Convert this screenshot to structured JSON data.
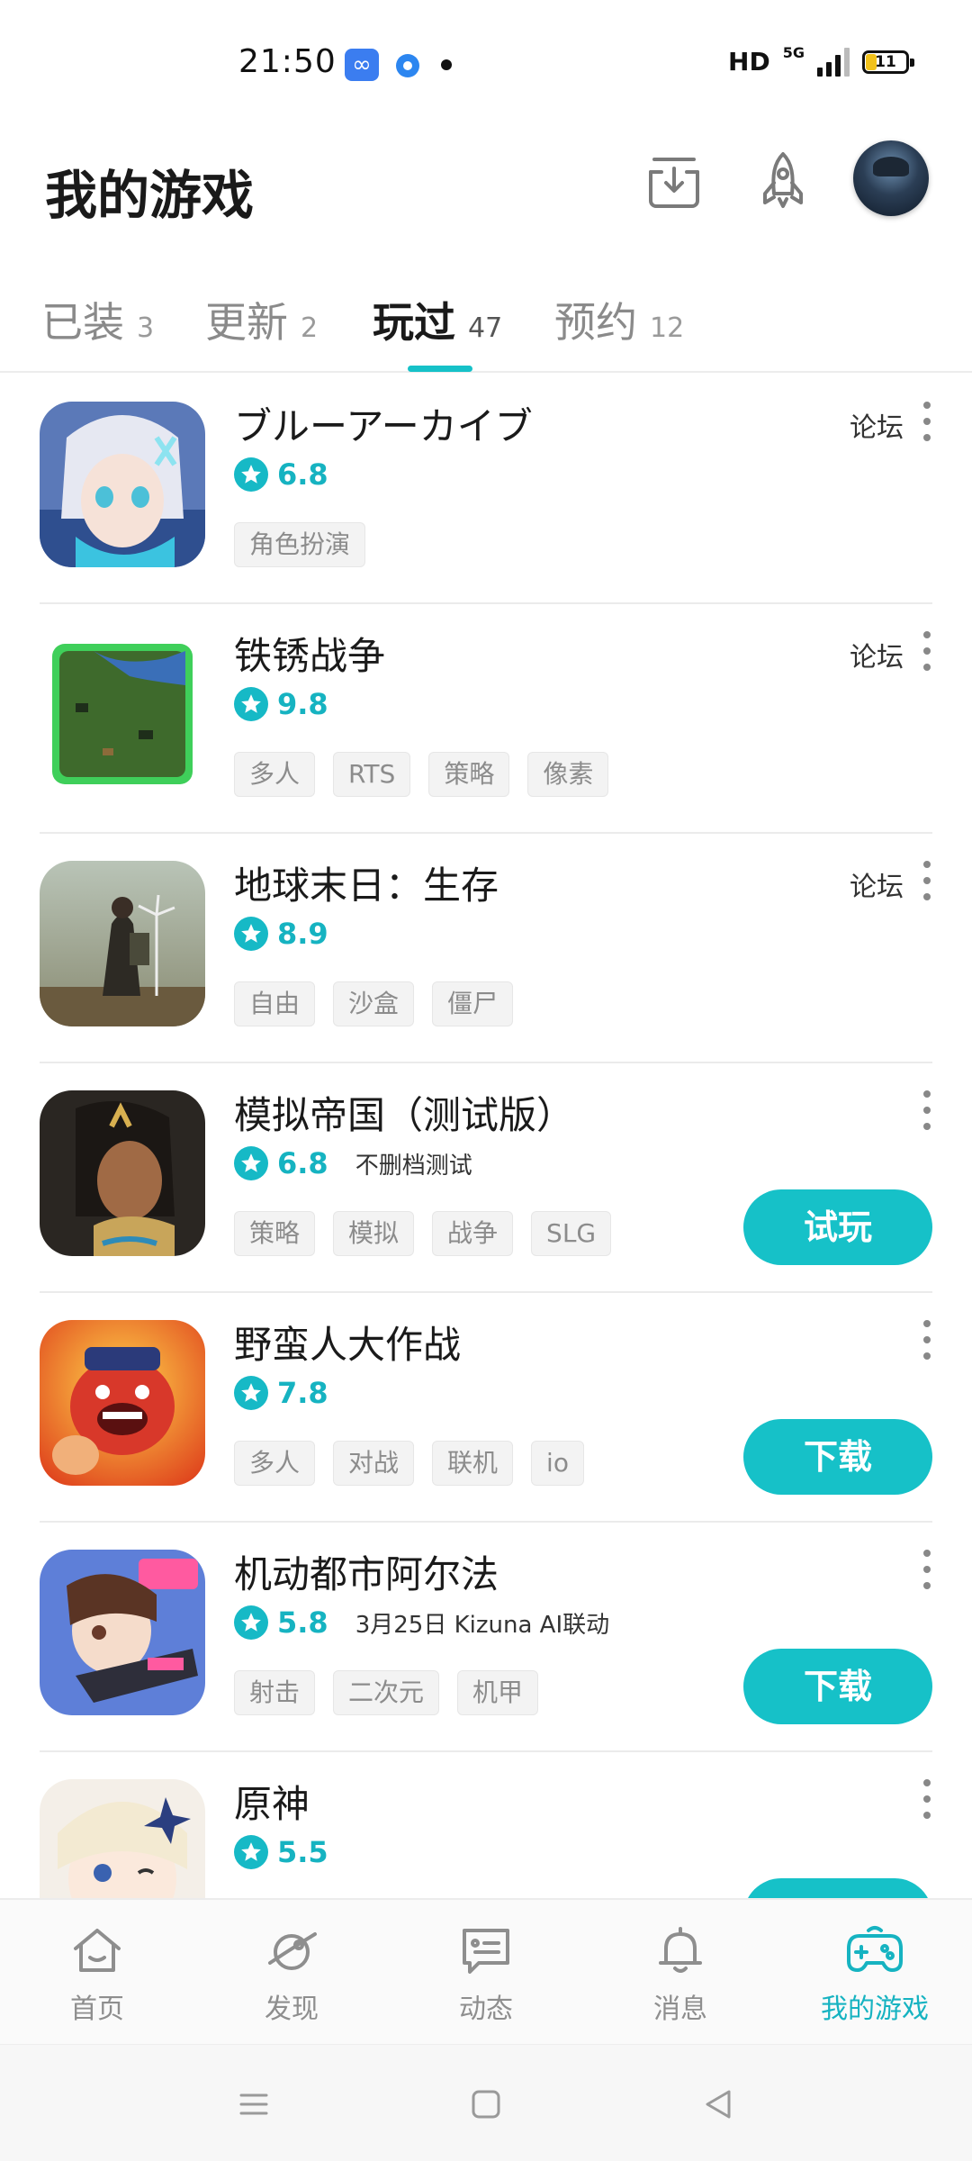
{
  "status_bar": {
    "time": "21:50",
    "network": "HD",
    "network_type": "5G",
    "battery": "11"
  },
  "header": {
    "title": "我的游戏"
  },
  "tabs": [
    {
      "label": "已装",
      "count": "3"
    },
    {
      "label": "更新",
      "count": "2"
    },
    {
      "label": "玩过",
      "count": "47",
      "active": true
    },
    {
      "label": "预约",
      "count": "12"
    }
  ],
  "games": [
    {
      "name": "ブルーアーカイブ",
      "rating": "6.8",
      "note": "",
      "tags": [
        "角色扮演"
      ],
      "forum": "论坛",
      "action": ""
    },
    {
      "name": "铁锈战争",
      "rating": "9.8",
      "note": "",
      "tags": [
        "多人",
        "RTS",
        "策略",
        "像素"
      ],
      "forum": "论坛",
      "action": ""
    },
    {
      "name": "地球末日：生存",
      "rating": "8.9",
      "note": "",
      "tags": [
        "自由",
        "沙盒",
        "僵尸"
      ],
      "forum": "论坛",
      "action": ""
    },
    {
      "name": "模拟帝国（测试版）",
      "rating": "6.8",
      "note": "不删档测试",
      "tags": [
        "策略",
        "模拟",
        "战争",
        "SLG"
      ],
      "forum": "",
      "action": "试玩"
    },
    {
      "name": "野蛮人大作战",
      "rating": "7.8",
      "note": "",
      "tags": [
        "多人",
        "对战",
        "联机",
        "io"
      ],
      "forum": "",
      "action": "下载"
    },
    {
      "name": "机动都市阿尔法",
      "rating": "5.8",
      "note": "3月25日 Kizuna AI联动",
      "tags": [
        "射击",
        "二次元",
        "机甲"
      ],
      "forum": "",
      "action": "下载"
    },
    {
      "name": "原神",
      "rating": "5.5",
      "note": "",
      "tags": [],
      "forum": "",
      "action": ""
    }
  ],
  "bottom_nav": [
    {
      "label": "首页",
      "icon": "home-icon"
    },
    {
      "label": "发现",
      "icon": "discover-planet-icon"
    },
    {
      "label": "动态",
      "icon": "feed-message-icon"
    },
    {
      "label": "消息",
      "icon": "bell-icon"
    },
    {
      "label": "我的游戏",
      "icon": "gamepad-icon",
      "active": true
    }
  ],
  "colors": {
    "accent": "#16c1c8",
    "rating": "#16b3c1"
  }
}
